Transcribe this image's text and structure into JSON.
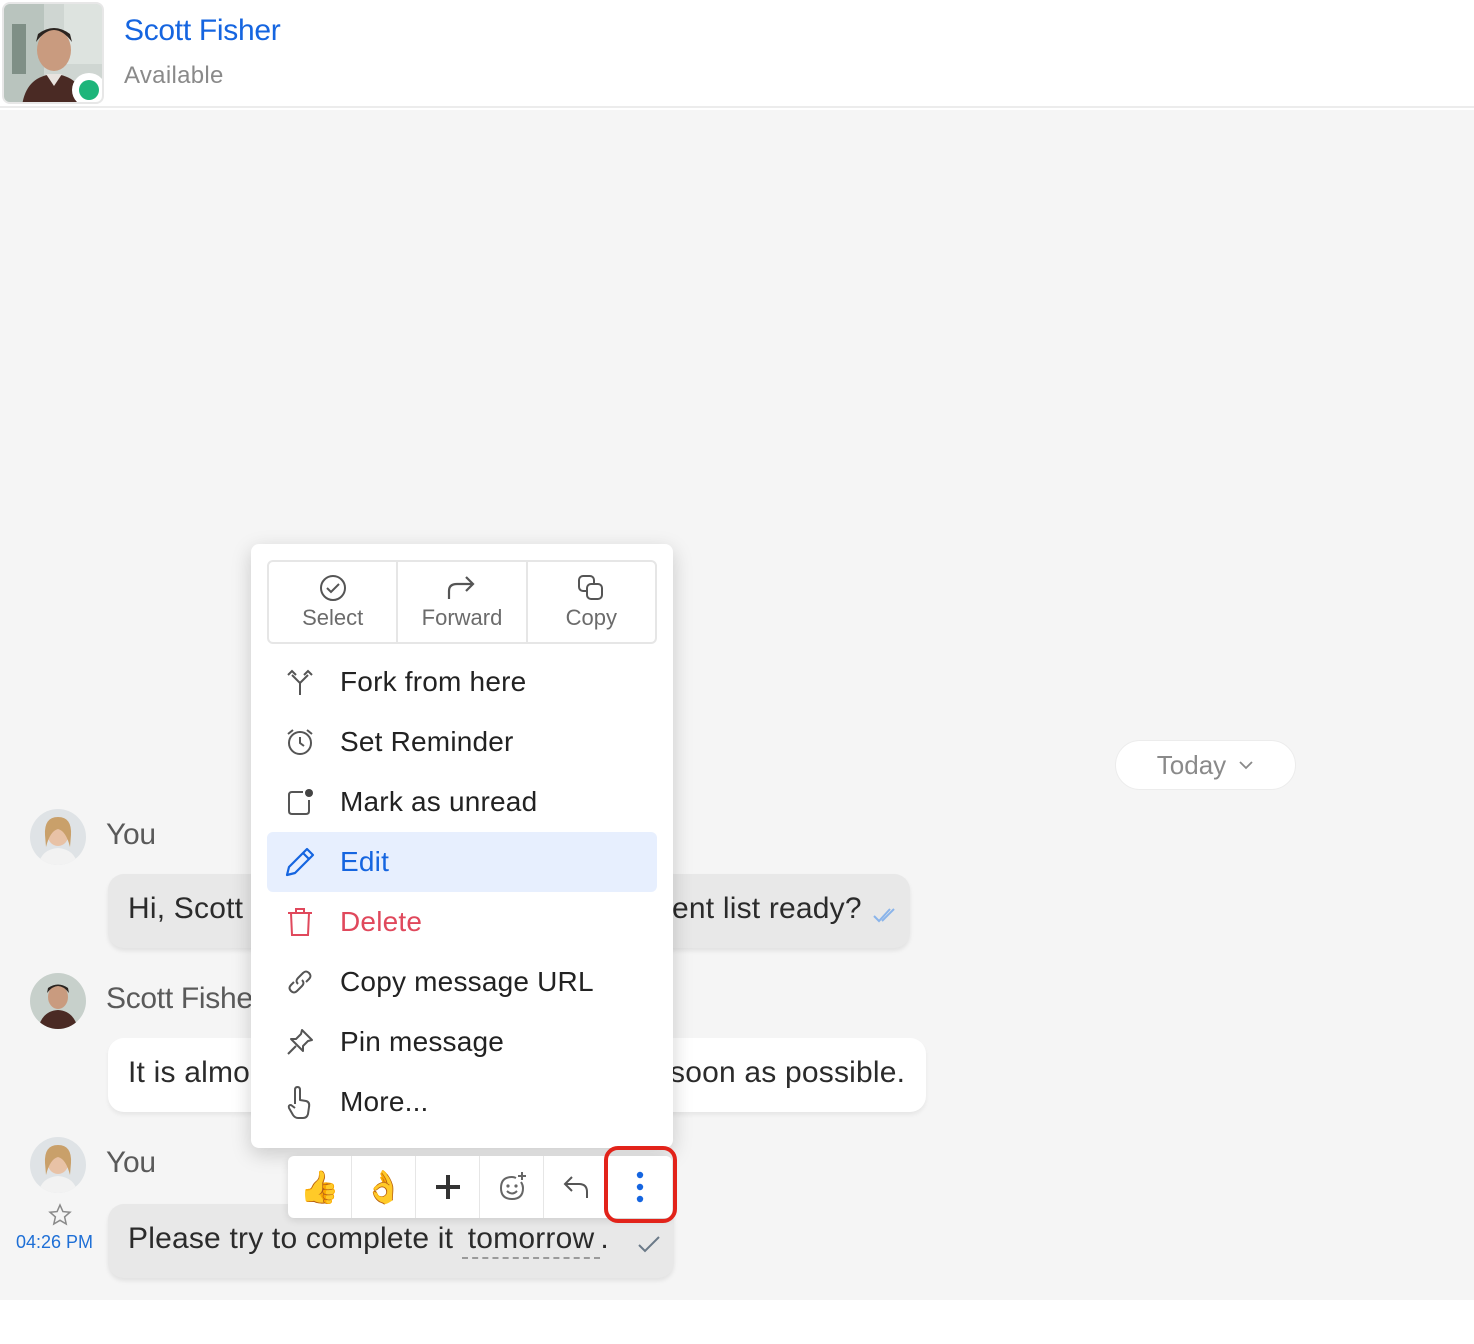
{
  "header": {
    "contact_name": "Scott Fisher",
    "status": "Available",
    "status_color": "#1db57a"
  },
  "date_separator": {
    "label": "Today"
  },
  "messages": [
    {
      "sender": "You",
      "text_start": "Hi, Scott",
      "text_end": "ent list ready?",
      "status": "read"
    },
    {
      "sender": "Scott Fishe",
      "text_start": "It is almo",
      "text_end": "soon as possible."
    },
    {
      "sender": "You",
      "text_prefix": "Please try to complete it",
      "text_highlight": "tomorrow",
      "text_suffix": ".",
      "time": "04:26 PM",
      "status": "sent"
    }
  ],
  "context_menu": {
    "quick_actions": [
      {
        "label": "Select",
        "icon": "check-circle-icon"
      },
      {
        "label": "Forward",
        "icon": "forward-icon"
      },
      {
        "label": "Copy",
        "icon": "copy-icon"
      }
    ],
    "items": [
      {
        "label": "Fork from here",
        "icon": "fork-icon"
      },
      {
        "label": "Set Reminder",
        "icon": "alarm-clock-icon"
      },
      {
        "label": "Mark as unread",
        "icon": "mark-unread-icon"
      },
      {
        "label": "Edit",
        "icon": "pencil-icon",
        "active": true
      },
      {
        "label": "Delete",
        "icon": "trash-icon",
        "danger": true
      },
      {
        "label": "Copy message URL",
        "icon": "link-icon"
      },
      {
        "label": "Pin message",
        "icon": "pin-icon"
      },
      {
        "label": "More...",
        "icon": "hand-pointer-icon"
      }
    ]
  },
  "reaction_bar": {
    "items": [
      "thumbs-up-emoji",
      "ok-hand-emoji",
      "add-reaction-icon",
      "emoji-picker-icon",
      "reply-icon",
      "more-options-icon"
    ],
    "thumbs_up": "👍",
    "ok_hand": "👌"
  },
  "colors": {
    "accent": "#1565e0",
    "danger": "#e0485c",
    "highlight_box": "#e2231a"
  }
}
